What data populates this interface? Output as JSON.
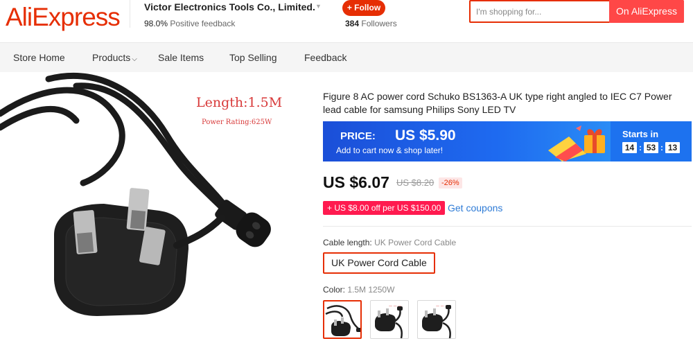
{
  "header": {
    "logo": "AliExpress",
    "store_name": "Victor Electronics Tools Co., Limited.",
    "positive_feedback_value": "98.0%",
    "positive_feedback_label": "Positive feedback",
    "follow_label": "+ Follow",
    "followers_count": "384",
    "followers_label": "Followers",
    "search_placeholder": "I'm shopping for...",
    "search_button": "On AliExpress"
  },
  "nav": {
    "items": [
      "Store Home",
      "Products",
      "Sale Items",
      "Top Selling",
      "Feedback"
    ]
  },
  "image": {
    "length_text": "Length:1.5M",
    "rating_text": "Power Rating:625W"
  },
  "product": {
    "title": "Figure 8 AC power cord Schuko BS1363-A UK type right angled to IEC C7 Power lead cable for samsung Philips Sony LED TV",
    "promo": {
      "price_label": "PRICE:",
      "price_value": "US $5.90",
      "sub_text": "Add to cart now & shop later!",
      "starts_in": "Starts in",
      "timer": [
        "14",
        "53",
        "13"
      ]
    },
    "price": "US $6.07",
    "old_price": "US $8.20",
    "discount": "-26%",
    "coupon_tag": "US $8.00 off per US $150.00",
    "coupon_icon": "+",
    "get_coupons": "Get coupons",
    "cable_length_label": "Cable length:",
    "cable_length_value": "UK Power Cord Cable",
    "cable_option": "UK Power Cord Cable",
    "color_label": "Color:",
    "color_value": "1.5M 1250W"
  },
  "colors": {
    "brand": "#e62e04",
    "banner_blue": "#1d6af0",
    "link": "#2e7bd6",
    "coupon": "#ff1a4f"
  }
}
